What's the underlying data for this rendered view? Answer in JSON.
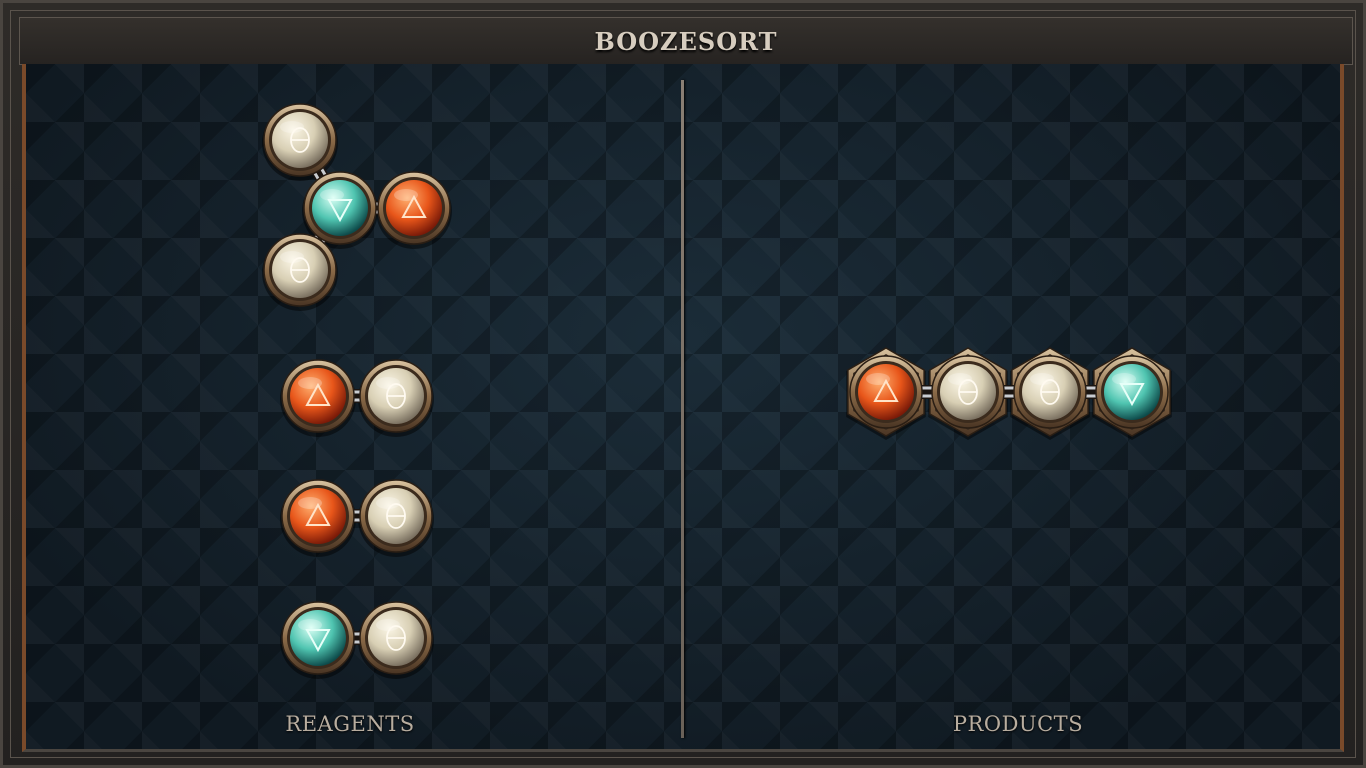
{
  "title": "BOOZESORT",
  "panels": {
    "reagents_label": "REAGENTS",
    "products_label": "PRODUCTS"
  },
  "atom_types": {
    "fire": {
      "icon": "triangle-up-icon",
      "colors": [
        "#ffb070",
        "#e8561a",
        "#7a1a08"
      ]
    },
    "water": {
      "icon": "triangle-down-icon",
      "colors": [
        "#d8fff4",
        "#4fc4b0",
        "#0d4a4a"
      ]
    },
    "salt": {
      "icon": "theta-icon",
      "colors": [
        "#fbf6e6",
        "#d8cfb4",
        "#7a7060"
      ]
    }
  },
  "reagents": [
    {
      "name": "reagent-molecule-1",
      "atoms": [
        "salt",
        "water",
        "fire",
        "salt"
      ],
      "bonds": [
        [
          0,
          1
        ],
        [
          1,
          2
        ],
        [
          1,
          3
        ]
      ]
    },
    {
      "name": "reagent-molecule-2",
      "atoms": [
        "fire",
        "salt"
      ],
      "bonds": [
        [
          0,
          1
        ]
      ]
    },
    {
      "name": "reagent-molecule-3",
      "atoms": [
        "fire",
        "salt"
      ],
      "bonds": [
        [
          0,
          1
        ]
      ]
    },
    {
      "name": "reagent-molecule-4",
      "atoms": [
        "water",
        "salt"
      ],
      "bonds": [
        [
          0,
          1
        ]
      ]
    }
  ],
  "products": [
    {
      "name": "product-molecule-1",
      "atoms": [
        "fire",
        "salt",
        "salt",
        "water"
      ],
      "bonds": [
        [
          0,
          1
        ],
        [
          1,
          2
        ],
        [
          2,
          3
        ]
      ]
    }
  ]
}
